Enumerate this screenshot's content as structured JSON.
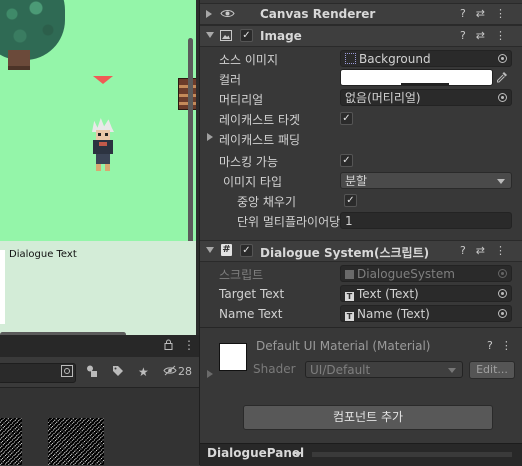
{
  "scene": {
    "dialogue_text": "Dialogue Text"
  },
  "project_toolbar": {
    "hidden_count": "28"
  },
  "canvas_renderer": {
    "title": "Canvas Renderer"
  },
  "image": {
    "title": "Image",
    "source_image_label": "소스 이미지",
    "source_image_value": "Background",
    "color_label": "컬러",
    "color_value": "#ffffff",
    "material_label": "머티리얼",
    "material_value": "없음(머티리얼)",
    "raycast_target_label": "레이캐스트 타겟",
    "raycast_padding_label": "레이캐스트 패딩",
    "maskable_label": "마스킹 가능",
    "image_type_label": "이미지 타입",
    "image_type_value": "분할",
    "fill_center_label": "중앙 채우기",
    "ppu_multiplier_label": "단위 멀티플라이어당",
    "ppu_multiplier_value": "1"
  },
  "dialogue_system": {
    "title": "Dialogue System(스크립트)",
    "script_label": "스크립트",
    "script_value": "DialogueSystem",
    "target_text_label": "Target Text",
    "target_text_value": "Text (Text)",
    "name_text_label": "Name Text",
    "name_text_value": "Name (Text)"
  },
  "material_panel": {
    "title": "Default UI Material (Material)",
    "shader_label": "Shader",
    "shader_value": "UI/Default",
    "edit_label": "Edit..."
  },
  "add_component_label": "컴포넌트 추가",
  "bottom_bar": {
    "object_name": "DialoguePanel"
  }
}
